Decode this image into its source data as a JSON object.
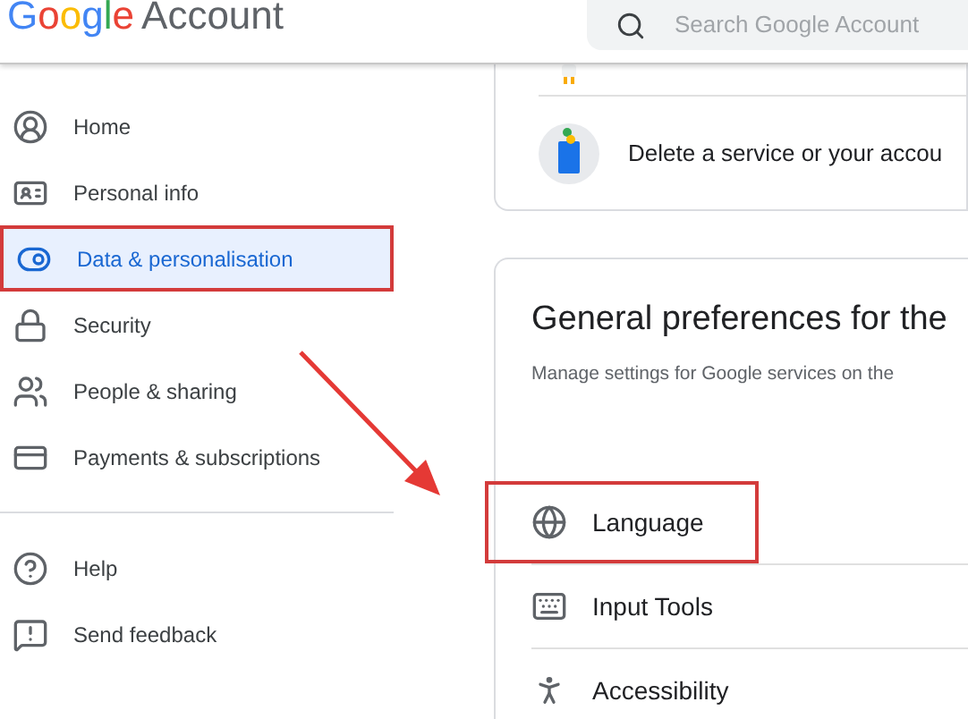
{
  "header": {
    "logo": "Google",
    "title": "Account",
    "search": {
      "placeholder": "Search Google Account"
    }
  },
  "sidebar": {
    "items": [
      {
        "kind": "home",
        "label": "Home",
        "selected": false,
        "highlighted": false
      },
      {
        "kind": "person",
        "label": "Personal info",
        "selected": false,
        "highlighted": false
      },
      {
        "kind": "toggle",
        "label": "Data & personalisation",
        "selected": true,
        "highlighted": true
      },
      {
        "kind": "lock",
        "label": "Security",
        "selected": false,
        "highlighted": false
      },
      {
        "kind": "people",
        "label": "People & sharing",
        "selected": false,
        "highlighted": false
      },
      {
        "kind": "card",
        "label": "Payments & subscriptions",
        "selected": false,
        "highlighted": false
      }
    ],
    "footer_items": [
      {
        "kind": "help",
        "label": "Help"
      },
      {
        "kind": "feedback",
        "label": "Send feedback"
      }
    ]
  },
  "services_card": {
    "row": "Delete a service or your accou"
  },
  "preferences_card": {
    "title": "General preferences for the",
    "subtitle": "Manage settings for Google services on the",
    "rows": [
      {
        "kind": "globe",
        "label": "Language",
        "highlighted": true
      },
      {
        "kind": "keyboard",
        "label": "Input Tools",
        "highlighted": false
      },
      {
        "kind": "accessibility",
        "label": "Accessibility",
        "highlighted": false
      }
    ]
  }
}
